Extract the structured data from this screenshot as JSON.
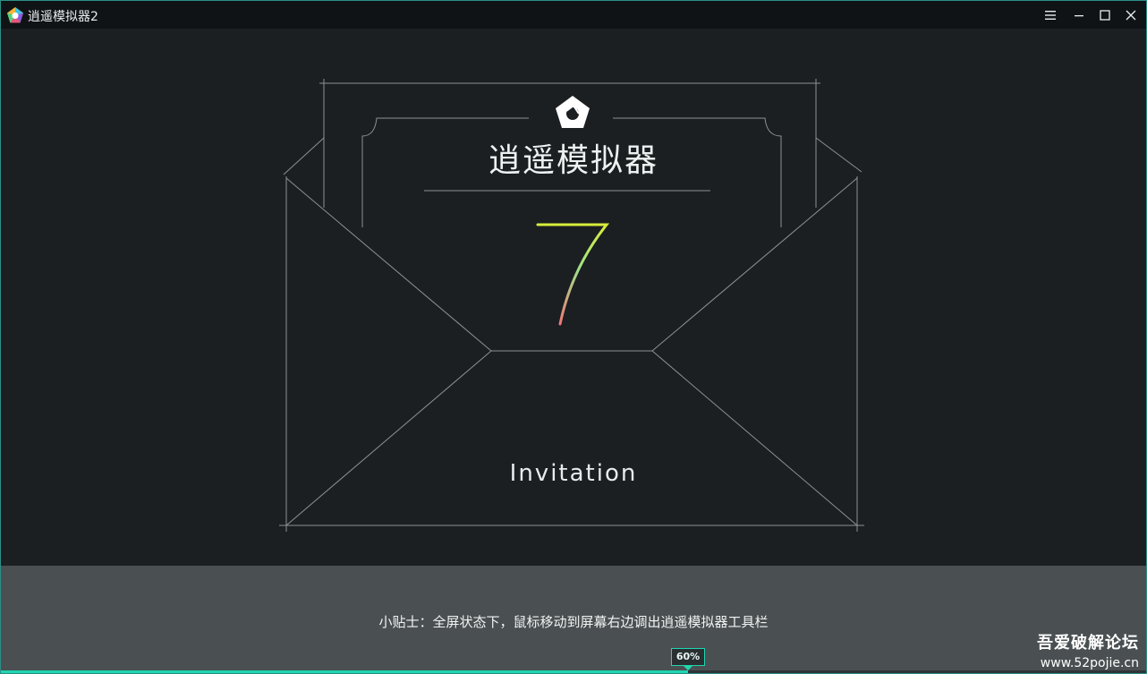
{
  "window": {
    "title": "逍遥模拟器2",
    "controls": [
      "menu-icon",
      "minimize-icon",
      "maximize-icon",
      "close-icon"
    ]
  },
  "splash": {
    "brand": "逍遥模拟器",
    "version_number": "7",
    "invitation": "Invitation"
  },
  "footer": {
    "tip": "小贴士：全屏状态下，鼠标移动到屏幕右边调出逍遥模拟器工具栏",
    "progress_label": "60%",
    "progress": 0.6
  },
  "watermark": {
    "line1": "吾爱破解论坛",
    "line2": "www.52pojie.cn"
  },
  "colors": {
    "accent": "#20d6b0",
    "background": "#1c1f21",
    "footer": "#4a5052"
  }
}
